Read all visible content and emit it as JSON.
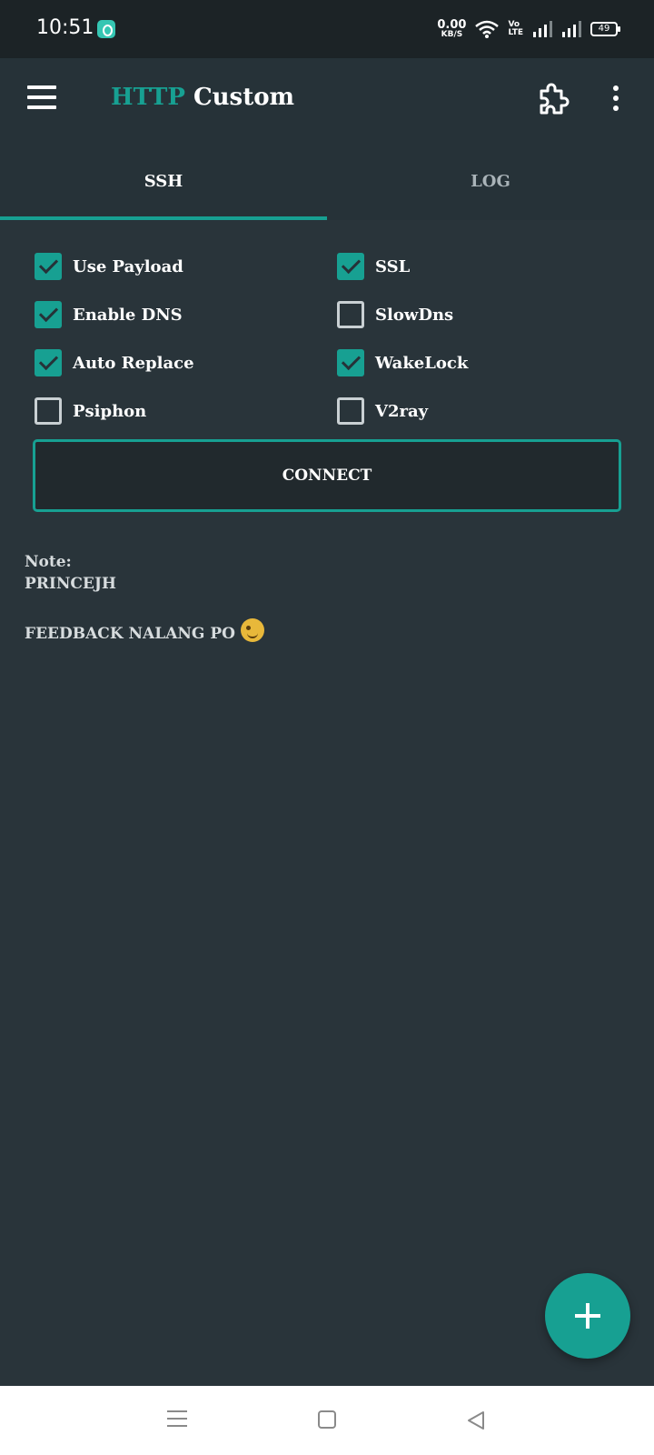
{
  "status_bar": {
    "time": "10:51",
    "net_speed_value": "0.00",
    "net_speed_unit": "KB/S",
    "volte_top": "Vo",
    "volte_bottom": "LTE",
    "battery": "49"
  },
  "app_bar": {
    "title_accent": "HTTP",
    "title_rest": "Custom"
  },
  "tabs": [
    {
      "label": "SSH",
      "active": true
    },
    {
      "label": "LOG",
      "active": false
    }
  ],
  "options": [
    {
      "label": "Use Payload",
      "checked": true
    },
    {
      "label": "SSL",
      "checked": true
    },
    {
      "label": "Enable DNS",
      "checked": true
    },
    {
      "label": "SlowDns",
      "checked": false
    },
    {
      "label": "Auto Replace",
      "checked": true
    },
    {
      "label": "WakeLock",
      "checked": true
    },
    {
      "label": "Psiphon",
      "checked": false
    },
    {
      "label": "V2ray",
      "checked": false
    }
  ],
  "connect_label": "CONNECT",
  "note": {
    "heading": "Note:",
    "line1": "PRINCEJH",
    "line2": "FEEDBACK NALANG PO"
  },
  "colors": {
    "accent": "#17a092",
    "background": "#29343a",
    "app_bar": "#263238"
  }
}
